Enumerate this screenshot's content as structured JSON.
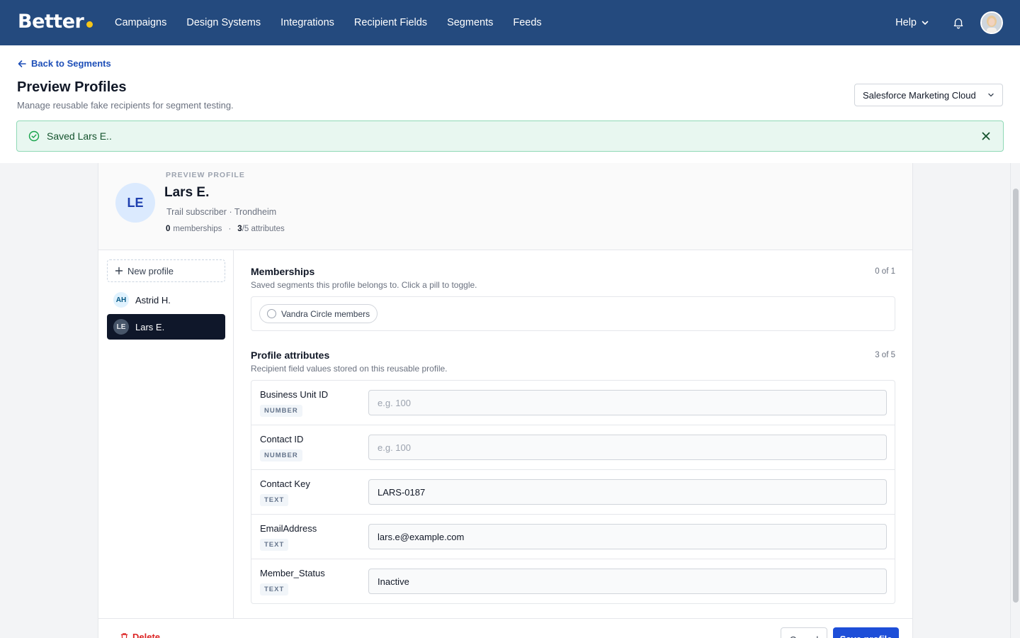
{
  "nav": {
    "logo": "Better",
    "links": [
      "Campaigns",
      "Design Systems",
      "Integrations",
      "Recipient Fields",
      "Segments",
      "Feeds"
    ],
    "help_label": "Help"
  },
  "header": {
    "back_label": "Back to Segments",
    "title": "Preview Profiles",
    "subtitle": "Manage reusable fake recipients for segment testing.",
    "platform_selected": "Salesforce Marketing Cloud"
  },
  "toast": {
    "message": "Saved Lars E.."
  },
  "profile": {
    "eyebrow": "PREVIEW PROFILE",
    "initials": "LE",
    "name": "Lars E.",
    "description": "Trail subscriber · Trondheim",
    "memberships_count": "0",
    "memberships_label": "memberships",
    "separator": "·",
    "attributes_count": "3",
    "attributes_total_label": "/5 attributes"
  },
  "sidebar": {
    "new_profile_label": "New profile",
    "profiles": [
      {
        "initials": "AH",
        "name": "Astrid H."
      },
      {
        "initials": "LE",
        "name": "Lars E."
      }
    ]
  },
  "memberships": {
    "title": "Memberships",
    "subtitle": "Saved segments this profile belongs to. Click a pill to toggle.",
    "count": "0 of 1",
    "pills": [
      "Vandra Circle members"
    ]
  },
  "attributes": {
    "title": "Profile attributes",
    "subtitle": "Recipient field values stored on this reusable profile.",
    "count": "3 of 5",
    "rows": [
      {
        "label": "Business Unit ID",
        "type": "NUMBER",
        "value": "",
        "placeholder": "e.g. 100"
      },
      {
        "label": "Contact ID",
        "type": "NUMBER",
        "value": "",
        "placeholder": "e.g. 100"
      },
      {
        "label": "Contact Key",
        "type": "TEXT",
        "value": "LARS-0187",
        "placeholder": ""
      },
      {
        "label": "EmailAddress",
        "type": "TEXT",
        "value": "lars.e@example.com",
        "placeholder": ""
      },
      {
        "label": "Member_Status",
        "type": "TEXT",
        "value": "Inactive",
        "placeholder": ""
      }
    ]
  },
  "footer": {
    "delete_label": "Delete",
    "cancel_label": "Cancel",
    "save_label": "Save profile"
  },
  "colors": {
    "nav_bg": "#244a7e",
    "accent": "#1d4ed8",
    "success_bg": "#e8f7f0",
    "danger": "#dc2626",
    "logo_dot": "#f5c518"
  }
}
